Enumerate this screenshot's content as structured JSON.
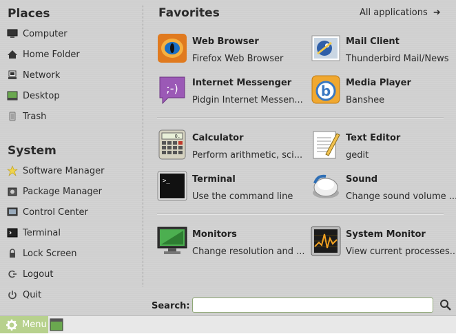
{
  "places": {
    "title": "Places",
    "items": [
      {
        "label": "Computer",
        "icon": "computer-icon"
      },
      {
        "label": "Home Folder",
        "icon": "home-icon"
      },
      {
        "label": "Network",
        "icon": "network-icon"
      },
      {
        "label": "Desktop",
        "icon": "desktop-icon"
      },
      {
        "label": "Trash",
        "icon": "trash-icon"
      }
    ]
  },
  "system": {
    "title": "System",
    "items": [
      {
        "label": "Software Manager",
        "icon": "software-manager-icon"
      },
      {
        "label": "Package Manager",
        "icon": "package-manager-icon"
      },
      {
        "label": "Control Center",
        "icon": "control-center-icon"
      },
      {
        "label": "Terminal",
        "icon": "terminal-icon"
      },
      {
        "label": "Lock Screen",
        "icon": "lock-icon"
      },
      {
        "label": "Logout",
        "icon": "logout-icon"
      },
      {
        "label": "Quit",
        "icon": "power-icon"
      }
    ]
  },
  "favorites": {
    "title": "Favorites",
    "all_apps_label": "All applications",
    "apps": [
      {
        "name": "Web Browser",
        "desc": "Firefox Web Browser",
        "icon": "firefox-icon"
      },
      {
        "name": "Mail Client",
        "desc": "Thunderbird Mail/News",
        "icon": "thunderbird-icon"
      },
      {
        "name": "Internet Messenger",
        "desc": "Pidgin Internet Messen...",
        "icon": "pidgin-icon"
      },
      {
        "name": "Media Player",
        "desc": "Banshee",
        "icon": "banshee-icon"
      },
      {
        "name": "Calculator",
        "desc": "Perform arithmetic, sci...",
        "icon": "calculator-icon"
      },
      {
        "name": "Text Editor",
        "desc": "gedit",
        "icon": "text-editor-icon"
      },
      {
        "name": "Terminal",
        "desc": "Use the command line",
        "icon": "terminal-icon"
      },
      {
        "name": "Sound",
        "desc": "Change sound volume ...",
        "icon": "sound-icon"
      },
      {
        "name": "Monitors",
        "desc": "Change resolution and ...",
        "icon": "monitors-icon"
      },
      {
        "name": "System Monitor",
        "desc": "View current processes...",
        "icon": "system-monitor-icon"
      }
    ]
  },
  "search": {
    "label": "Search:",
    "value": "",
    "placeholder": ""
  },
  "panel": {
    "menu_label": "Menu"
  },
  "colors": {
    "panel_accent": "#b7d18d",
    "background": "#d2d2d2"
  }
}
